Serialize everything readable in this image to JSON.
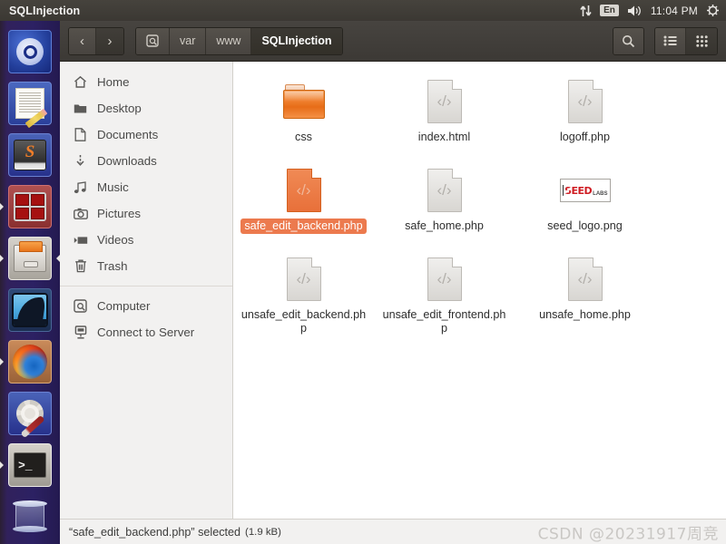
{
  "panel": {
    "title": "SQLInjection",
    "indicators": {
      "network_icon": "network-updown-icon",
      "keyboard_layout": "En",
      "volume_icon": "volume-icon",
      "clock": "11:04 PM",
      "system_menu_icon": "gear-power-icon"
    }
  },
  "dock": {
    "items": [
      {
        "name": "dash-home",
        "icon": "ubuntu-logo-icon",
        "running": false,
        "focused": false
      },
      {
        "name": "text-editor",
        "icon": "text-editor-icon",
        "running": false,
        "focused": false
      },
      {
        "name": "seed-book",
        "icon": "seed-book-icon",
        "running": false,
        "focused": false
      },
      {
        "name": "terminator",
        "icon": "terminator-icon",
        "running": true,
        "focused": false
      },
      {
        "name": "files",
        "icon": "file-manager-icon",
        "running": true,
        "focused": true
      },
      {
        "name": "wireshark",
        "icon": "wireshark-icon",
        "running": false,
        "focused": false
      },
      {
        "name": "firefox",
        "icon": "firefox-icon",
        "running": true,
        "focused": false
      },
      {
        "name": "system-tools",
        "icon": "settings-tools-icon",
        "running": false,
        "focused": false
      },
      {
        "name": "terminal",
        "icon": "terminal-icon",
        "running": true,
        "focused": false
      },
      {
        "name": "trash",
        "icon": "trash-icon",
        "running": false,
        "focused": false
      }
    ]
  },
  "toolbar": {
    "back_label": "‹",
    "forward_label": "›",
    "breadcrumbs": [
      {
        "label": "",
        "icon": "computer-icon",
        "active": false
      },
      {
        "label": "var",
        "icon": "",
        "active": false
      },
      {
        "label": "www",
        "icon": "",
        "active": false
      },
      {
        "label": "SQLInjection",
        "icon": "",
        "active": true
      }
    ],
    "search_icon": "search-icon",
    "list_view_icon": "list-view-icon",
    "grid_view_icon": "grid-view-icon",
    "active_view": "grid"
  },
  "sidebar": {
    "places": [
      {
        "label": "Home",
        "icon": "home-icon"
      },
      {
        "label": "Desktop",
        "icon": "desktop-folder-icon"
      },
      {
        "label": "Documents",
        "icon": "document-icon"
      },
      {
        "label": "Downloads",
        "icon": "download-icon"
      },
      {
        "label": "Music",
        "icon": "music-note-icon"
      },
      {
        "label": "Pictures",
        "icon": "camera-icon"
      },
      {
        "label": "Videos",
        "icon": "video-icon"
      },
      {
        "label": "Trash",
        "icon": "trash-icon"
      }
    ],
    "devices": [
      {
        "label": "Computer",
        "icon": "computer-icon"
      },
      {
        "label": "Connect to Server",
        "icon": "server-icon"
      }
    ]
  },
  "files": [
    {
      "name": "css",
      "type": "folder",
      "icon": "folder-icon",
      "selected": false
    },
    {
      "name": "index.html",
      "type": "code",
      "icon": "code-file-icon",
      "selected": false
    },
    {
      "name": "logoff.php",
      "type": "code",
      "icon": "code-file-icon",
      "selected": false
    },
    {
      "name": "safe_edit_backend.php",
      "type": "code",
      "icon": "code-file-icon",
      "selected": true
    },
    {
      "name": "safe_home.php",
      "type": "code",
      "icon": "code-file-icon",
      "selected": false
    },
    {
      "name": "seed_logo.png",
      "type": "image",
      "icon": "image-thumbnail-icon",
      "selected": false
    },
    {
      "name": "unsafe_edit_backend.php",
      "type": "code",
      "icon": "code-file-icon",
      "selected": false
    },
    {
      "name": "unsafe_edit_frontend.php",
      "type": "code",
      "icon": "code-file-icon",
      "selected": false
    },
    {
      "name": "unsafe_home.php",
      "type": "code",
      "icon": "code-file-icon",
      "selected": false
    }
  ],
  "file_icon_glyph": "‹/›",
  "image_thumbnail": {
    "brand": "SEED",
    "suffix": "LABS"
  },
  "statusbar": {
    "text": "“safe_edit_backend.php” selected",
    "size": "(1.9 kB)",
    "watermark": "CSDN @20231917周竞"
  },
  "colors": {
    "panel_bg": "#3c3935",
    "accent_orange": "#ec7a4e",
    "sidebar_bg": "#f2f1f0",
    "content_bg": "#ffffff",
    "dock_bg": "#2c2163"
  }
}
